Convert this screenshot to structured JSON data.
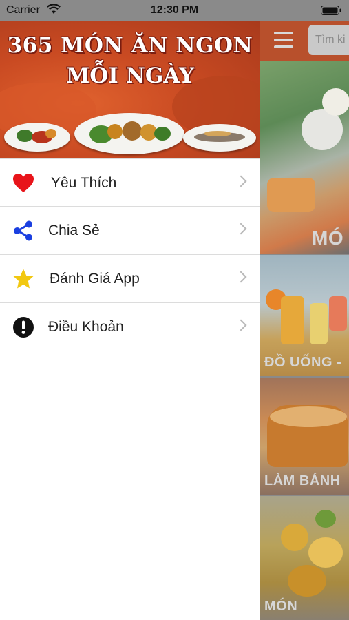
{
  "status_bar": {
    "carrier": "Carrier",
    "time": "12:30 PM"
  },
  "drawer": {
    "banner": {
      "title_line1": "365 MÓN ĂN NGON",
      "title_line2": "MỖI NGÀY"
    },
    "items": [
      {
        "label": "Yêu Thích",
        "icon": "heart-icon",
        "icon_color": "#e8141a"
      },
      {
        "label": "Chia Sẻ",
        "icon": "share-icon",
        "icon_color": "#1a3fe0"
      },
      {
        "label": "Đánh Giá App",
        "icon": "star-icon",
        "icon_color": "#f2c811"
      },
      {
        "label": "Điều Khoản",
        "icon": "info-icon",
        "icon_color": "#111111"
      }
    ]
  },
  "main": {
    "search_placeholder": "Tìm ki",
    "categories": [
      {
        "label": "MÓ"
      },
      {
        "label": "ĐỒ UỐNG -"
      },
      {
        "label": "LÀM BÁNH"
      },
      {
        "label": "MÓN"
      }
    ]
  },
  "colors": {
    "navbar": "#b8502c",
    "accent_red": "#e8141a"
  }
}
